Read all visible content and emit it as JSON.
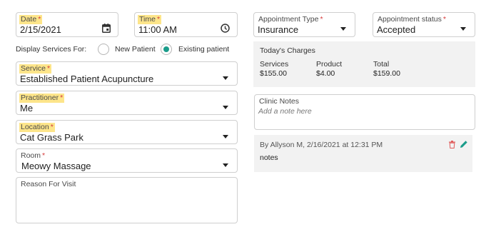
{
  "date": {
    "label": "Date",
    "value": "2/15/2021"
  },
  "time": {
    "label": "Time",
    "value": "11:00 AM"
  },
  "display_services": {
    "label": "Display Services For:",
    "options": [
      "New Patient",
      "Existing patient"
    ],
    "selected": "Existing patient"
  },
  "service": {
    "label": "Service",
    "value": "Established Patient Acupuncture"
  },
  "practitioner": {
    "label": "Practitioner",
    "value": "Me"
  },
  "location": {
    "label": "Location",
    "value": "Cat Grass Park"
  },
  "room": {
    "label": "Room",
    "value": "Meowy Massage"
  },
  "reason": {
    "label": "Reason For Visit",
    "value": ""
  },
  "appointment_type": {
    "label": "Appointment Type",
    "value": "Insurance"
  },
  "appointment_status": {
    "label": "Appointment status",
    "value": "Accepted"
  },
  "charges": {
    "title": "Today's Charges",
    "columns": [
      {
        "label": "Services",
        "value": "$155.00"
      },
      {
        "label": "Product",
        "value": "$4.00"
      },
      {
        "label": "Total",
        "value": "$159.00"
      }
    ]
  },
  "clinic_notes": {
    "label": "Clinic Notes",
    "placeholder": "Add a note here"
  },
  "note_entry": {
    "meta": "By Allyson M, 2/16/2021 at 12:31 PM",
    "text": "notes"
  },
  "required_mark": "*",
  "colors": {
    "highlight": "#fde58a",
    "required": "#d63a3a",
    "accent": "#1a9c8a",
    "panel": "#f2f2f2",
    "delete_icon": "#e05a5a"
  },
  "icons": [
    "calendar-icon",
    "clock-icon",
    "chevron-down-icon",
    "delete-icon",
    "edit-icon"
  ]
}
